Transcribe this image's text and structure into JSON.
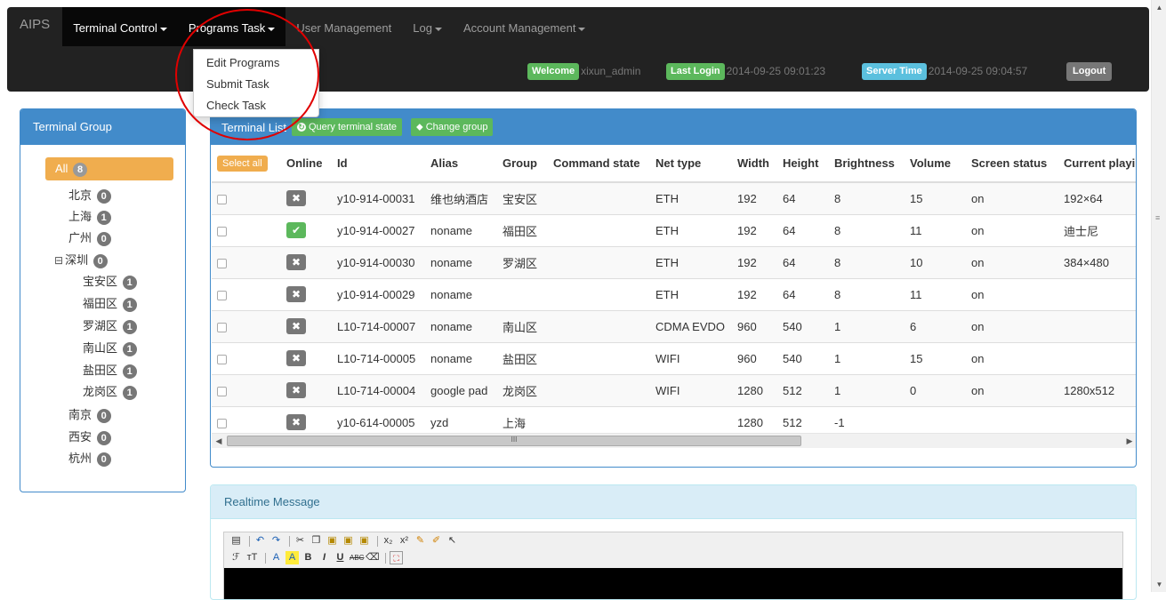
{
  "navbar": {
    "brand": "AIPS",
    "menus": [
      {
        "label": "Terminal Control",
        "dropdown": true
      },
      {
        "label": "Programs Task",
        "dropdown": true
      },
      {
        "label": "User Management",
        "dropdown": false
      },
      {
        "label": "Log",
        "dropdown": true
      },
      {
        "label": "Account Management",
        "dropdown": true
      }
    ],
    "programs_menu": [
      "Edit Programs",
      "Submit Task",
      "Check Task"
    ],
    "welcome_label": "Welcome",
    "username": "xixun_admin",
    "last_login_label": "Last Login",
    "last_login": "2014-09-25 09:01:23",
    "server_time_label": "Server Time",
    "server_time": "2014-09-25 09:04:57",
    "logout": "Logout"
  },
  "group_panel": {
    "title": "Terminal Group",
    "all_label": "All",
    "all_count": "8",
    "nodes": [
      {
        "name": "北京",
        "count": "0"
      },
      {
        "name": "上海",
        "count": "1"
      },
      {
        "name": "广州",
        "count": "0"
      },
      {
        "name": "深圳",
        "count": "0",
        "expanded": true
      },
      {
        "name": "宝安区",
        "count": "1"
      },
      {
        "name": "福田区",
        "count": "1"
      },
      {
        "name": "罗湖区",
        "count": "1"
      },
      {
        "name": "南山区",
        "count": "1"
      },
      {
        "name": "盐田区",
        "count": "1"
      },
      {
        "name": "龙岗区",
        "count": "1"
      },
      {
        "name": "南京",
        "count": "0"
      },
      {
        "name": "西安",
        "count": "0"
      },
      {
        "name": "杭州",
        "count": "0"
      }
    ],
    "collapse_symbol": "⊟"
  },
  "terminal_list": {
    "title": "Terminal List",
    "query_button": "Query terminal state",
    "change_group_button": "Change group",
    "select_all": "Select all",
    "columns": [
      "Online",
      "Id",
      "Alias",
      "Group",
      "Command state",
      "Net type",
      "Width",
      "Height",
      "Brightness",
      "Volume",
      "Screen status",
      "Current playing"
    ],
    "rows": [
      {
        "online": false,
        "id": "y10-914-00031",
        "alias": "维也纳酒店",
        "group": "宝安区",
        "command": "",
        "net": "ETH",
        "width": "192",
        "height": "64",
        "brightness": "8",
        "volume": "15",
        "screen": "on",
        "playing": "192×64"
      },
      {
        "online": true,
        "id": "y10-914-00027",
        "alias": "noname",
        "group": "福田区",
        "command": "",
        "net": "ETH",
        "width": "192",
        "height": "64",
        "brightness": "8",
        "volume": "11",
        "screen": "on",
        "playing": "迪士尼"
      },
      {
        "online": false,
        "id": "y10-914-00030",
        "alias": "noname",
        "group": "罗湖区",
        "command": "",
        "net": "ETH",
        "width": "192",
        "height": "64",
        "brightness": "8",
        "volume": "10",
        "screen": "on",
        "playing": "384×480"
      },
      {
        "online": false,
        "id": "y10-914-00029",
        "alias": "noname",
        "group": "",
        "command": "",
        "net": "ETH",
        "width": "192",
        "height": "64",
        "brightness": "8",
        "volume": "11",
        "screen": "on",
        "playing": ""
      },
      {
        "online": false,
        "id": "L10-714-00007",
        "alias": "noname",
        "group": "南山区",
        "command": "",
        "net": "CDMA EVDO",
        "width": "960",
        "height": "540",
        "brightness": "1",
        "volume": "6",
        "screen": "on",
        "playing": ""
      },
      {
        "online": false,
        "id": "L10-714-00005",
        "alias": "noname",
        "group": "盐田区",
        "command": "",
        "net": "WIFI",
        "width": "960",
        "height": "540",
        "brightness": "1",
        "volume": "15",
        "screen": "on",
        "playing": ""
      },
      {
        "online": false,
        "id": "L10-714-00004",
        "alias": "google pad",
        "group": "龙岗区",
        "command": "",
        "net": "WIFI",
        "width": "1280",
        "height": "512",
        "brightness": "1",
        "volume": "0",
        "screen": "on",
        "playing": "1280x512"
      },
      {
        "online": false,
        "id": "y10-614-00005",
        "alias": "yzd",
        "group": "上海",
        "command": "",
        "net": "",
        "width": "1280",
        "height": "512",
        "brightness": "-1",
        "volume": "",
        "screen": "",
        "playing": ""
      }
    ],
    "online_glyph": "✔",
    "offline_glyph": "✖",
    "scroll_thumb_mark": "III"
  },
  "realtime": {
    "title": "Realtime Message"
  },
  "colors": {
    "navbar": "#222222",
    "primary": "#428bca",
    "success": "#5cb85c",
    "warning": "#f0ad4e",
    "info": "#5bc0de",
    "annotation_red": "#e00000"
  }
}
